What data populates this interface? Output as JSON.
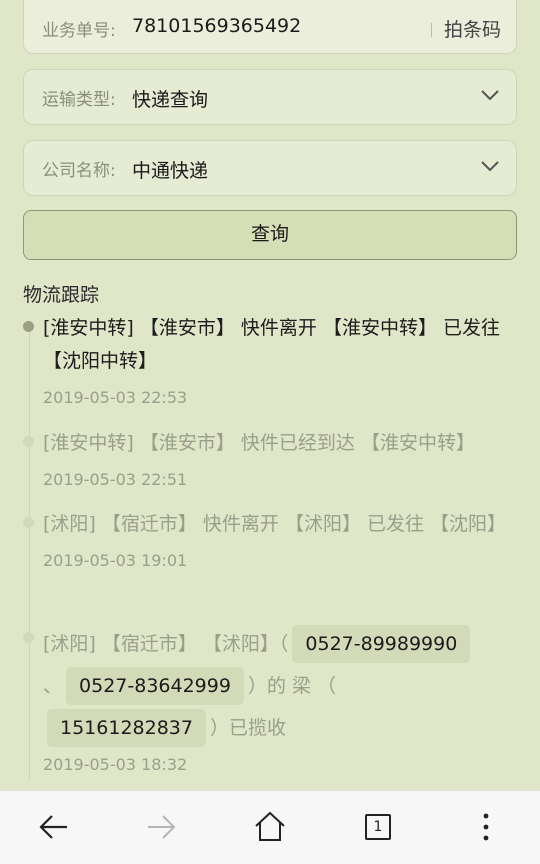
{
  "form": {
    "order_label": "业务单号:",
    "order_value": "78101569365492",
    "scan_label": "拍条码",
    "transport_label": "运输类型:",
    "transport_value": "快递查询",
    "company_label": "公司名称:",
    "company_value": "中通快递",
    "query_label": "查询"
  },
  "tracking": {
    "title": "物流跟踪",
    "events": [
      {
        "desc": "[淮安中转] 【淮安市】 快件离开 【淮安中转】 已发往 【沈阳中转】",
        "time": "2019-05-03 22:53"
      },
      {
        "desc": "[淮安中转] 【淮安市】 快件已经到达 【淮安中转】",
        "time": "2019-05-03 22:51"
      },
      {
        "desc": "[沭阳] 【宿迁市】 快件离开 【沭阳】 已发往 【沈阳】",
        "time": "2019-05-03 19:01"
      },
      {
        "desc_a": "[沭阳] 【宿迁市】 【沭阳】（",
        "phone1": "0527-89989990",
        "sep1": "、",
        "phone2": "0527-83642999",
        "desc_b": "）的 梁 （",
        "phone3": "15161282837",
        "desc_c": "）已揽收",
        "time": "2019-05-03 18:32"
      }
    ]
  },
  "nav": {
    "tab_count": "1",
    "icons": [
      "back-arrow-icon",
      "forward-arrow-icon",
      "home-icon",
      "tabs-icon",
      "more-icon"
    ]
  },
  "colors": {
    "background": "#e0e6c8",
    "chip": "#d3dab8",
    "active_dot": "#9ba085"
  }
}
